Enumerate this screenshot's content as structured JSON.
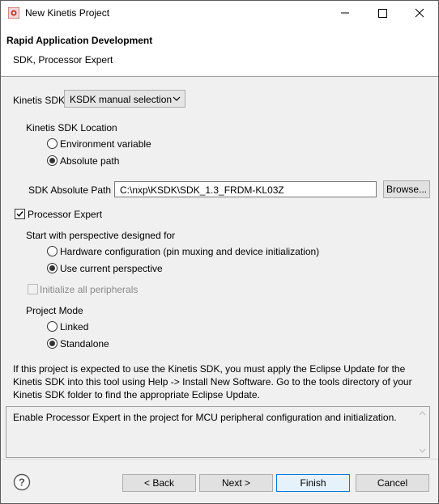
{
  "window": {
    "title": "New Kinetis Project",
    "accent_color": "#0078d7"
  },
  "header": {
    "title": "Rapid Application Development",
    "subtitle": "SDK, Processor Expert"
  },
  "kinetis_sdk": {
    "label": "Kinetis SDK",
    "selected": "KSDK manual selection"
  },
  "sdk_location": {
    "group_label": "Kinetis SDK Location",
    "options": [
      "Environment variable",
      "Absolute path"
    ],
    "selected": "Absolute path"
  },
  "sdk_path": {
    "label": "SDK Absolute Path",
    "value": "C:\\nxp\\KSDK\\SDK_1.3_FRDM-KL03Z",
    "browse_label": "Browse..."
  },
  "processor_expert": {
    "label": "Processor Expert",
    "checked": true
  },
  "perspective": {
    "group_label": "Start with perspective designed for",
    "options": [
      "Hardware configuration (pin muxing and device initialization)",
      "Use current perspective"
    ],
    "selected": "Use current perspective"
  },
  "init_peripherals": {
    "label": "Initialize all peripherals",
    "checked": false,
    "enabled": false
  },
  "project_mode": {
    "group_label": "Project Mode",
    "options": [
      "Linked",
      "Standalone"
    ],
    "selected": "Standalone"
  },
  "info_text": {
    "line1": "If this project is expected to use the Kinetis SDK, you must apply the Eclipse Update for the",
    "line2": "Kinetis SDK into this tool using Help -> Install New Software. Go to the tools directory of your",
    "line3": "Kinetis SDK folder to find the appropriate Eclipse Update."
  },
  "description": "Enable Processor Expert in the project for MCU peripheral configuration and initialization.",
  "footer": {
    "back_label": "< Back",
    "next_label": "Next >",
    "finish_label": "Finish",
    "cancel_label": "Cancel"
  },
  "icons": {
    "app": "kinetis-app-icon",
    "minimize": "minimize-icon",
    "maximize": "maximize-icon",
    "close": "close-icon",
    "help": "help-icon",
    "dropdown": "chevron-down-icon"
  }
}
